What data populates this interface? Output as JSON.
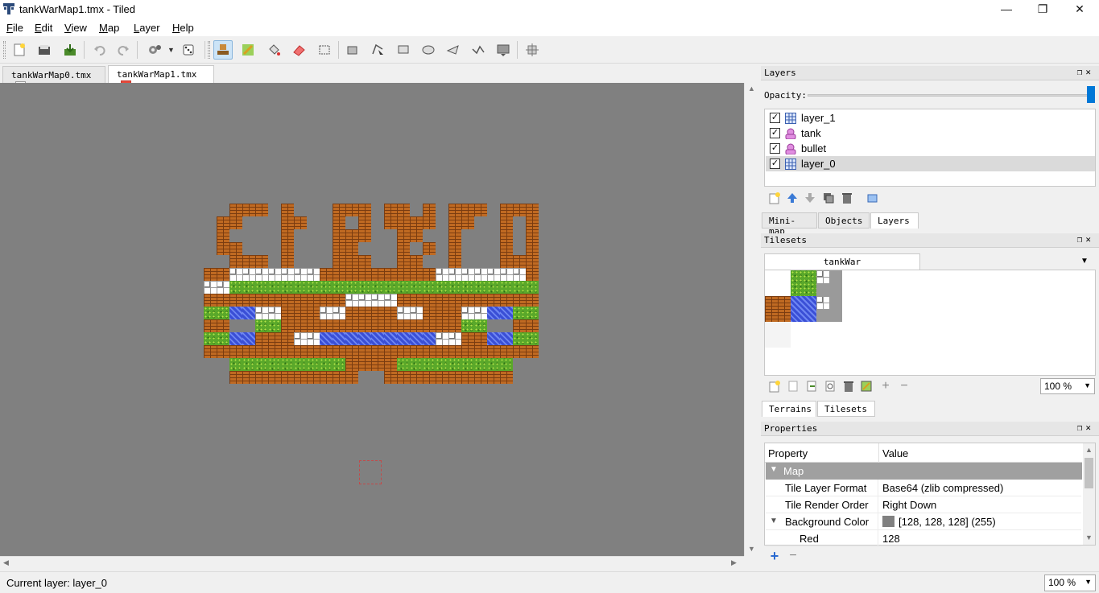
{
  "window": {
    "title": "tankWarMap1.tmx - Tiled",
    "minimize": "—",
    "maximize": "❐",
    "close": "✕"
  },
  "menu": [
    {
      "label": "File",
      "u": "F",
      "rest": "ile"
    },
    {
      "label": "Edit",
      "u": "E",
      "rest": "dit"
    },
    {
      "label": "View",
      "u": "V",
      "rest": "iew"
    },
    {
      "label": "Map",
      "u": "M",
      "rest": "ap"
    },
    {
      "label": "Layer",
      "u": "L",
      "rest": "ayer"
    },
    {
      "label": "Help",
      "u": "H",
      "rest": "elp"
    }
  ],
  "tabs": [
    {
      "label": "tankWarMap0.tmx",
      "active": false
    },
    {
      "label": "tankWarMap1.tmx",
      "active": true
    }
  ],
  "layers_panel": {
    "title": "Layers",
    "opacity_label": "Opacity:",
    "opacity_value": 1.0,
    "layers": [
      {
        "name": "layer_1",
        "type": "tile",
        "visible": true,
        "selected": false
      },
      {
        "name": "tank",
        "type": "object",
        "visible": true,
        "selected": false
      },
      {
        "name": "bullet",
        "type": "object",
        "visible": true,
        "selected": false
      },
      {
        "name": "layer_0",
        "type": "tile",
        "visible": true,
        "selected": true
      }
    ],
    "tabs": [
      "Mini-map",
      "Objects",
      "Layers"
    ],
    "active_tab": "Layers"
  },
  "tilesets_panel": {
    "title": "Tilesets",
    "tileset_tab": "tankWar",
    "zoom": "100 %",
    "tabs": [
      "Terrains",
      "Tilesets"
    ],
    "active_tab": "Tilesets"
  },
  "properties_panel": {
    "title": "Properties",
    "col_property": "Property",
    "col_value": "Value",
    "group": "Map",
    "rows": [
      {
        "key": "Tile Layer Format",
        "value": "Base64 (zlib compressed)"
      },
      {
        "key": "Tile Render Order",
        "value": "Right Down"
      },
      {
        "key": "Background Color",
        "value": "[128, 128, 128] (255)",
        "swatch": "#808080"
      },
      {
        "key": "Red",
        "value": "128"
      }
    ]
  },
  "status": {
    "current_layer": "Current layer: layer_0",
    "zoom": "100 %"
  },
  "colors": {
    "canvas_bg": "#808080",
    "brick": "#c06a22",
    "grass": "#5aa82a",
    "water": "#3a4fd6",
    "steel": "#9a9a9a"
  }
}
